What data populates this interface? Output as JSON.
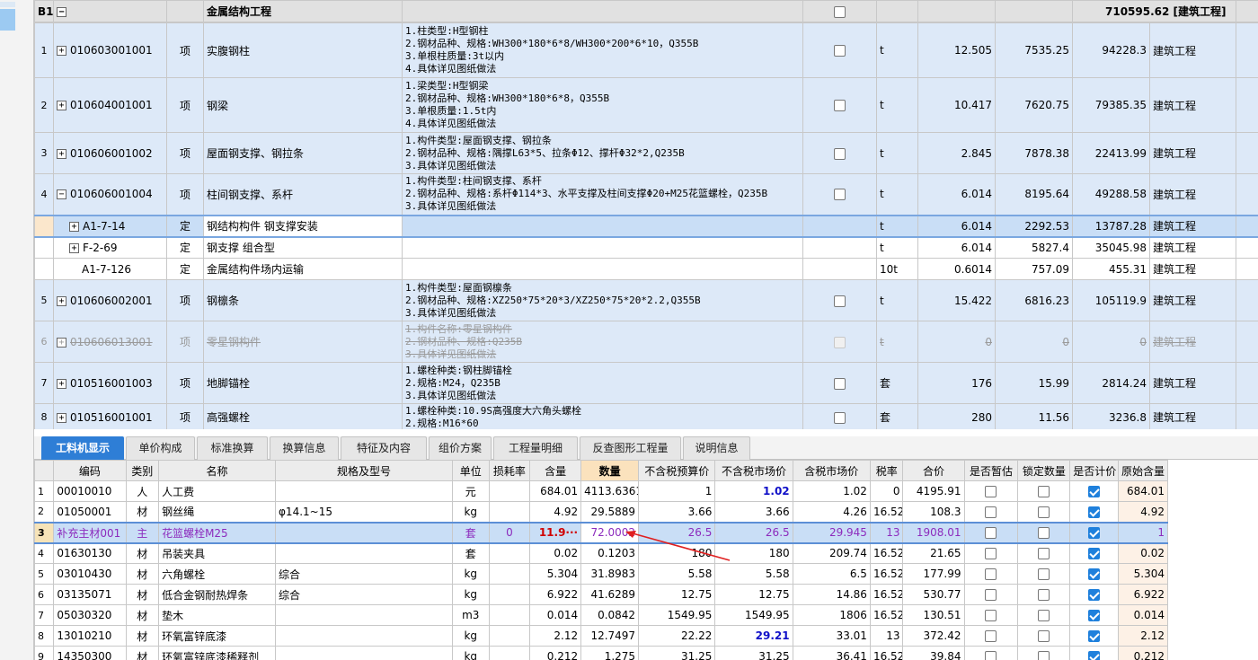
{
  "upper": {
    "header": {
      "rn": "B1",
      "name": "金属结构工程",
      "total": "710595.62",
      "major": "[建筑工程]"
    },
    "rows": [
      {
        "rn": "1",
        "code": "010603001001",
        "type": "项",
        "name": "实腹钢柱",
        "desc": [
          "1.柱类型:H型钢柱",
          "2.钢材品种、规格:WH300*180*6*8/WH300*200*6*10，Q355B",
          "3.单根柱质量:3t以内",
          "4.具体详见图纸做法"
        ],
        "unit": "t",
        "qty": "12.505",
        "price": "7535.25",
        "total": "94228.3",
        "major": "建筑工程"
      },
      {
        "rn": "2",
        "code": "010604001001",
        "type": "项",
        "name": "钢梁",
        "desc": [
          "1.梁类型:H型钢梁",
          "2.钢材品种、规格:WH300*180*6*8，Q355B",
          "3.单根质量:1.5t内",
          "4.具体详见图纸做法"
        ],
        "unit": "t",
        "qty": "10.417",
        "price": "7620.75",
        "total": "79385.35",
        "major": "建筑工程"
      },
      {
        "rn": "3",
        "code": "010606001002",
        "type": "项",
        "name": "屋面钢支撑、钢拉条",
        "desc": [
          "1.构件类型:屋面钢支撑、钢拉条",
          "2.钢材品种、规格:隅撑L63*5、拉条Φ12、撑杆Φ32*2,Q235B",
          "3.具体详见图纸做法"
        ],
        "unit": "t",
        "qty": "2.845",
        "price": "7878.38",
        "total": "22413.99",
        "major": "建筑工程"
      },
      {
        "rn": "4",
        "code": "010606001004",
        "type": "项",
        "name": "柱间钢支撑、系杆",
        "desc": [
          "1.构件类型:柱间钢支撑、系杆",
          "2.钢材品种、规格:系杆Φ114*3、水平支撑及柱间支撑Φ20+M25花篮螺栓，Q235B",
          "3.具体详见图纸做法"
        ],
        "unit": "t",
        "qty": "6.014",
        "price": "8195.64",
        "total": "49288.58",
        "major": "建筑工程"
      },
      {
        "rn": "",
        "code": "A1-7-14",
        "type": "定",
        "name": "钢结构构件 钢支撑安装",
        "unit": "t",
        "qty": "6.014",
        "price": "2292.53",
        "total": "13787.28",
        "major": "建筑工程"
      },
      {
        "rn": "",
        "code": "F-2-69",
        "type": "定",
        "name": "钢支撑 组合型",
        "unit": "t",
        "qty": "6.014",
        "price": "5827.4",
        "total": "35045.98",
        "major": "建筑工程"
      },
      {
        "rn": "",
        "code": "A1-7-126",
        "type": "定",
        "name": "金属结构件场内运输",
        "unit": "10t",
        "qty": "0.6014",
        "price": "757.09",
        "total": "455.31",
        "major": "建筑工程"
      },
      {
        "rn": "5",
        "code": "010606002001",
        "type": "项",
        "name": "钢檩条",
        "desc": [
          "1.构件类型:屋面钢檩条",
          "2.钢材品种、规格:XZ250*75*20*3/XZ250*75*20*2.2,Q355B",
          "3.具体详见图纸做法"
        ],
        "unit": "t",
        "qty": "15.422",
        "price": "6816.23",
        "total": "105119.9",
        "major": "建筑工程"
      },
      {
        "rn": "6",
        "code": "010606013001",
        "type": "项",
        "name": "零星钢构件",
        "desc": [
          "1.构件名称:零星钢构件",
          "2.钢材品种、规格:Q235B",
          "3.具体详见图纸做法"
        ],
        "unit": "t",
        "qty": "0",
        "price": "0",
        "total": "0",
        "major": "建筑工程"
      },
      {
        "rn": "7",
        "code": "010516001003",
        "type": "项",
        "name": "地脚锚栓",
        "desc": [
          "1.螺栓种类:钢柱脚锚栓",
          "2.规格:M24，Q235B",
          "3.具体详见图纸做法"
        ],
        "unit": "套",
        "qty": "176",
        "price": "15.99",
        "total": "2814.24",
        "major": "建筑工程"
      },
      {
        "rn": "8",
        "code": "010516001001",
        "type": "项",
        "name": "高强螺栓",
        "desc": [
          "1.螺栓种类:10.9S高强度大六角头螺栓",
          "2.规格:M16*60"
        ],
        "unit": "套",
        "qty": "280",
        "price": "11.56",
        "total": "3236.8",
        "major": "建筑工程"
      }
    ]
  },
  "tabs": [
    "工料机显示",
    "单价构成",
    "标准换算",
    "换算信息",
    "特征及内容",
    "组价方案",
    "工程量明细",
    "反查图形工程量",
    "说明信息"
  ],
  "lower": {
    "headers": [
      "编码",
      "类别",
      "名称",
      "规格及型号",
      "单位",
      "损耗率",
      "含量",
      "数量",
      "不含税预算价",
      "不含税市场价",
      "含税市场价",
      "税率",
      "合价",
      "是否暂估",
      "锁定数量",
      "是否计价",
      "原始含量"
    ],
    "rows": [
      {
        "rn": "1",
        "code": "00010010",
        "cat": "人",
        "name": "人工费",
        "spec": "",
        "unit": "元",
        "loss": "",
        "content": "684.01",
        "qty": "4113.6361",
        "budget": "1",
        "market": "1.02",
        "taxmarket": "1.02",
        "rate": "0",
        "total": "4195.91",
        "orig": "684.01"
      },
      {
        "rn": "2",
        "code": "01050001",
        "cat": "材",
        "name": "钢丝绳",
        "spec": "φ14.1~15",
        "unit": "kg",
        "loss": "",
        "content": "4.92",
        "qty": "29.5889",
        "budget": "3.66",
        "market": "3.66",
        "taxmarket": "4.26",
        "rate": "16.52",
        "total": "108.3",
        "orig": "4.92"
      },
      {
        "rn": "3",
        "code": "补充主材001",
        "cat": "主",
        "name": "花篮螺栓M25",
        "spec": "",
        "unit": "套",
        "loss": "0",
        "content": "11.9···",
        "qty": "72.0002",
        "budget": "26.5",
        "market": "26.5",
        "taxmarket": "29.945",
        "rate": "13",
        "total": "1908.01",
        "orig": "1"
      },
      {
        "rn": "4",
        "code": "01630130",
        "cat": "材",
        "name": "吊装夹具",
        "spec": "",
        "unit": "套",
        "loss": "",
        "content": "0.02",
        "qty": "0.1203",
        "budget": "180",
        "market": "180",
        "taxmarket": "209.74",
        "rate": "16.52",
        "total": "21.65",
        "orig": "0.02"
      },
      {
        "rn": "5",
        "code": "03010430",
        "cat": "材",
        "name": "六角螺栓",
        "spec": "综合",
        "unit": "kg",
        "loss": "",
        "content": "5.304",
        "qty": "31.8983",
        "budget": "5.58",
        "market": "5.58",
        "taxmarket": "6.5",
        "rate": "16.52",
        "total": "177.99",
        "orig": "5.304"
      },
      {
        "rn": "6",
        "code": "03135071",
        "cat": "材",
        "name": "低合金钢耐热焊条",
        "spec": "综合",
        "unit": "kg",
        "loss": "",
        "content": "6.922",
        "qty": "41.6289",
        "budget": "12.75",
        "market": "12.75",
        "taxmarket": "14.86",
        "rate": "16.52",
        "total": "530.77",
        "orig": "6.922"
      },
      {
        "rn": "7",
        "code": "05030320",
        "cat": "材",
        "name": "垫木",
        "spec": "",
        "unit": "m3",
        "loss": "",
        "content": "0.014",
        "qty": "0.0842",
        "budget": "1549.95",
        "market": "1549.95",
        "taxmarket": "1806",
        "rate": "16.52",
        "total": "130.51",
        "orig": "0.014"
      },
      {
        "rn": "8",
        "code": "13010210",
        "cat": "材",
        "name": "环氧富锌底漆",
        "spec": "",
        "unit": "kg",
        "loss": "",
        "content": "2.12",
        "qty": "12.7497",
        "budget": "22.22",
        "market": "29.21",
        "taxmarket": "33.01",
        "rate": "13",
        "total": "372.42",
        "orig": "2.12"
      },
      {
        "rn": "9",
        "code": "14350300",
        "cat": "材",
        "name": "环氧富锌底漆稀释剂",
        "spec": "",
        "unit": "kg",
        "loss": "",
        "content": "0.212",
        "qty": "1.275",
        "budget": "31.25",
        "market": "31.25",
        "taxmarket": "36.41",
        "rate": "16.52",
        "total": "39.84",
        "orig": "0.212"
      }
    ]
  },
  "colors": {
    "accent": "#2e7ed6",
    "selected_row": "#c9def6",
    "row_blue": "#dde9f8",
    "arrow": "#e02020",
    "material_text": "#8c2bbd"
  }
}
